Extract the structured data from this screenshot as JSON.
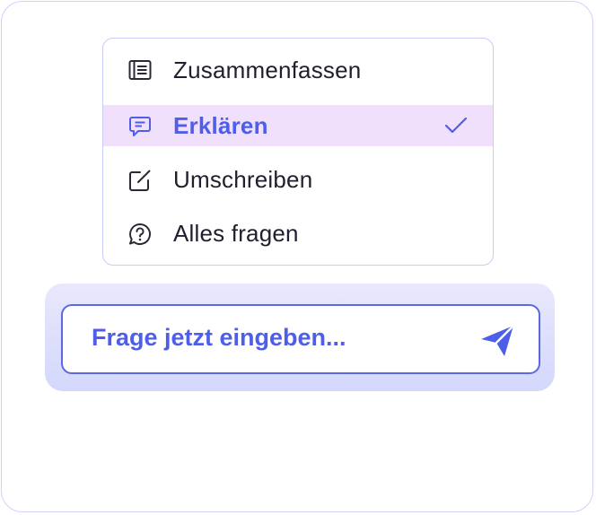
{
  "menu": {
    "items": [
      {
        "label": "Zusammenfassen",
        "icon": "list-document-icon",
        "selected": false
      },
      {
        "label": "Erklären",
        "icon": "chat-bubble-icon",
        "selected": true
      },
      {
        "label": "Umschreiben",
        "icon": "edit-icon",
        "selected": false
      },
      {
        "label": "Alles fragen",
        "icon": "question-bubble-icon",
        "selected": false
      }
    ],
    "selected_icon": "checkmark-icon"
  },
  "input": {
    "placeholder": "Frage jetzt eingeben...",
    "send_icon": "send-icon"
  },
  "colors": {
    "accent": "#4f5ee8",
    "selected_bg": "#f1e0fc",
    "border": "#cfd2fb",
    "text": "#1f1f2e"
  }
}
